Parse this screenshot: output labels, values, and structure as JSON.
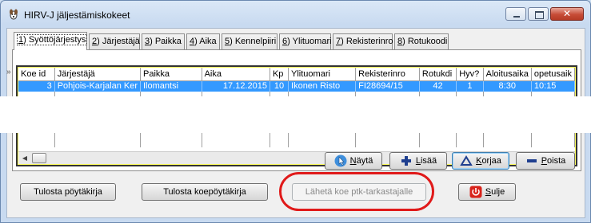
{
  "window": {
    "title": "HIRV-J jäljestämiskokeet"
  },
  "tabs": [
    {
      "num": "1",
      "label": ") Syöttöjärjestys"
    },
    {
      "num": "2",
      "label": ") Järjestäjä"
    },
    {
      "num": "3",
      "label": ") Paikka"
    },
    {
      "num": "4",
      "label": ") Aika"
    },
    {
      "num": "5",
      "label": ") Kennelpiiri"
    },
    {
      "num": "6",
      "label": ") Ylituomari"
    },
    {
      "num": "7",
      "label": ") Rekisterinro"
    },
    {
      "num": "8",
      "label": ") Rotukoodi"
    }
  ],
  "grid": {
    "row_indicator": "»",
    "columns": [
      "Koe id",
      "Järjestäjä",
      "Paikka",
      "Aika",
      "Kp",
      "Ylituomari",
      "Rekisterinro",
      "Rotukdi",
      "Hyv?",
      "Aloitusaika",
      "opetusaik"
    ],
    "rows": [
      {
        "koe_id": "3",
        "jarjestaja": "Pohjois-Karjalan Ker",
        "paikka": "Ilomantsi",
        "aika": "17.12.2015",
        "kp": "10",
        "ylituomari": "Ikonen Risto",
        "rekisterinro": "FI28694/15",
        "rotukdi": "42",
        "hyv": "1",
        "aloitusaika": "8:30",
        "opetusaika": "10:15"
      }
    ]
  },
  "buttons": {
    "nayta": {
      "pre": "",
      "u": "N",
      "post": "äytä"
    },
    "lisaa": {
      "pre": "",
      "u": "L",
      "post": "isää"
    },
    "korjaa": {
      "pre": "",
      "u": "K",
      "post": "orjaa"
    },
    "poista": {
      "pre": "",
      "u": "P",
      "post": "oista"
    },
    "tulosta_poytakirja": "Tulosta pöytäkirja",
    "tulosta_koepoytakirja": "Tulosta koepöytäkirja",
    "laheta": "Lähetä koe ptk-tarkastajalle",
    "sulje": {
      "pre": "",
      "u": "S",
      "post": "ulje"
    }
  },
  "colors": {
    "selection": "#3399ff",
    "highlight_ellipse": "#e01a1a"
  }
}
